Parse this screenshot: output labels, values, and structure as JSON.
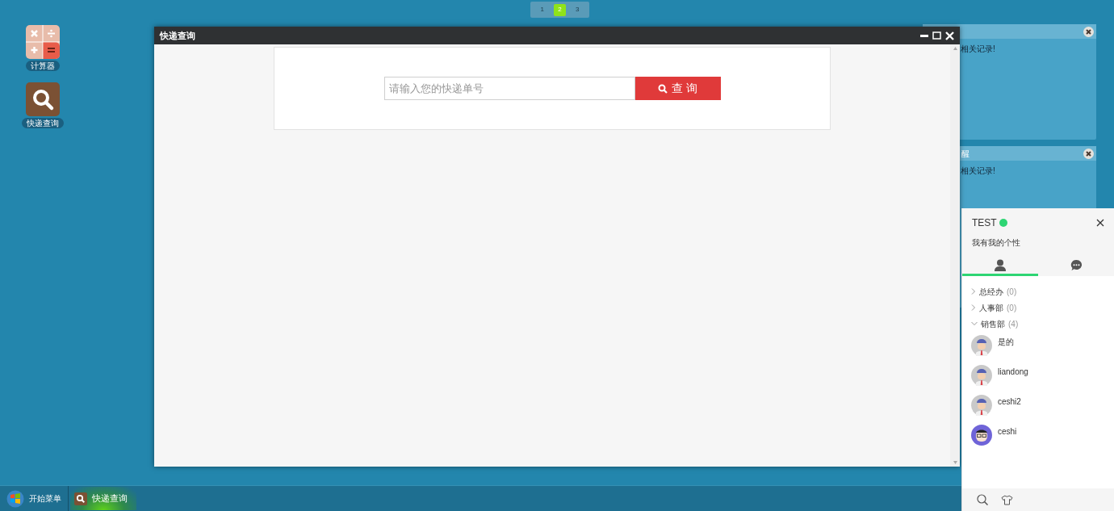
{
  "desktop_icons": [
    {
      "kind": "calculator",
      "label": "计算器"
    },
    {
      "kind": "search",
      "label": "快递查询"
    }
  ],
  "pager": [
    {
      "label": "1",
      "selected": false
    },
    {
      "label": "2",
      "selected": true
    },
    {
      "label": "3",
      "selected": false
    }
  ],
  "notices": [
    {
      "text": "相关记录!"
    },
    {
      "title": "醒",
      "text": "相关记录!"
    }
  ],
  "window": {
    "title": "快递查询",
    "search": {
      "placeholder": "请输入您的快递单号",
      "button": "查 询"
    }
  },
  "chat_panel": {
    "user": "TEST",
    "online": true,
    "signature": "我有我的个性",
    "tabs": [
      {
        "kind": "contacts",
        "selected": true
      },
      {
        "kind": "chats",
        "selected": false
      }
    ],
    "groups": [
      {
        "name": "总经办",
        "count": "(0)",
        "expanded": false
      },
      {
        "name": "人事部",
        "count": "(0)",
        "expanded": false
      },
      {
        "name": "销售部",
        "count": "(4)",
        "expanded": true,
        "children": [
          {
            "name": "是的",
            "kind": "man"
          },
          {
            "name": "liandong",
            "kind": "man"
          },
          {
            "name": "ceshi2",
            "kind": "man"
          },
          {
            "name": "ceshi",
            "kind": "glasses"
          }
        ]
      }
    ]
  },
  "taskbar": {
    "start": "开始菜单",
    "tasks": [
      {
        "label": "快递查询",
        "selected": true
      }
    ]
  }
}
